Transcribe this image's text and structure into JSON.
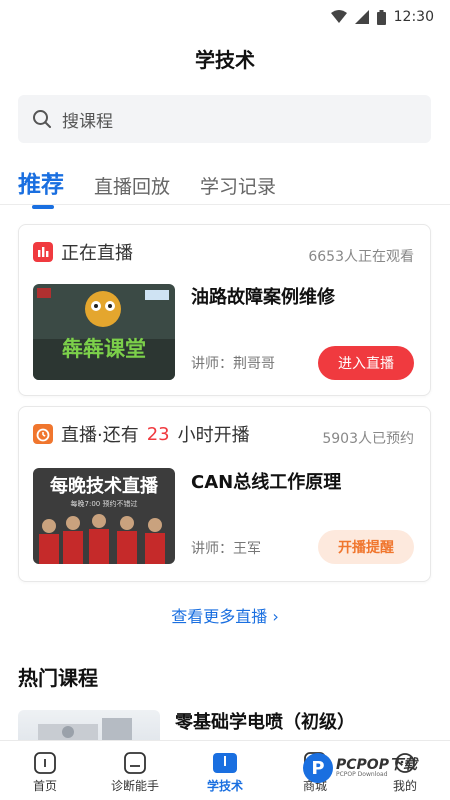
{
  "status_bar": {
    "time": "12:30"
  },
  "header": {
    "title": "学技术"
  },
  "search": {
    "placeholder": "搜课程"
  },
  "tabs": [
    {
      "label": "推荐",
      "active": true
    },
    {
      "label": "直播回放",
      "active": false
    },
    {
      "label": "学习记录",
      "active": false
    }
  ],
  "live_card": {
    "status": "正在直播",
    "viewers": "6653人正在观看",
    "title": "油路故障案例维修",
    "teacher_prefix": "讲师：",
    "teacher": "荆哥哥",
    "button": "进入直播",
    "thumb_text": "犇犇课堂"
  },
  "upcoming_card": {
    "status_prefix": "直播·还有",
    "hours": "23",
    "status_suffix": "小时开播",
    "reservations": "5903人已预约",
    "title": "CAN总线工作原理",
    "teacher_prefix": "讲师：",
    "teacher": "王军",
    "button": "开播提醒",
    "thumb_title": "每晚技术直播",
    "thumb_sub": "每晚7:00  预约不错过"
  },
  "more_live": {
    "label": "查看更多直播"
  },
  "hot_courses": {
    "title": "热门课程",
    "items": [
      {
        "title": "零基础学电喷（初级）"
      }
    ]
  },
  "bottom_nav": [
    {
      "label": "首页",
      "icon": "home-icon"
    },
    {
      "label": "诊断能手",
      "icon": "diagnose-icon"
    },
    {
      "label": "学技术",
      "icon": "book-icon",
      "active": true
    },
    {
      "label": "商城",
      "icon": "shop-icon"
    },
    {
      "label": "我的",
      "icon": "profile-icon"
    }
  ],
  "watermark": {
    "text": "PCPOP下载",
    "sub": "PCPOP Download"
  },
  "colors": {
    "accent": "#1a6fe0",
    "live_red": "#f03a3f",
    "remind_orange": "#f0762e"
  }
}
